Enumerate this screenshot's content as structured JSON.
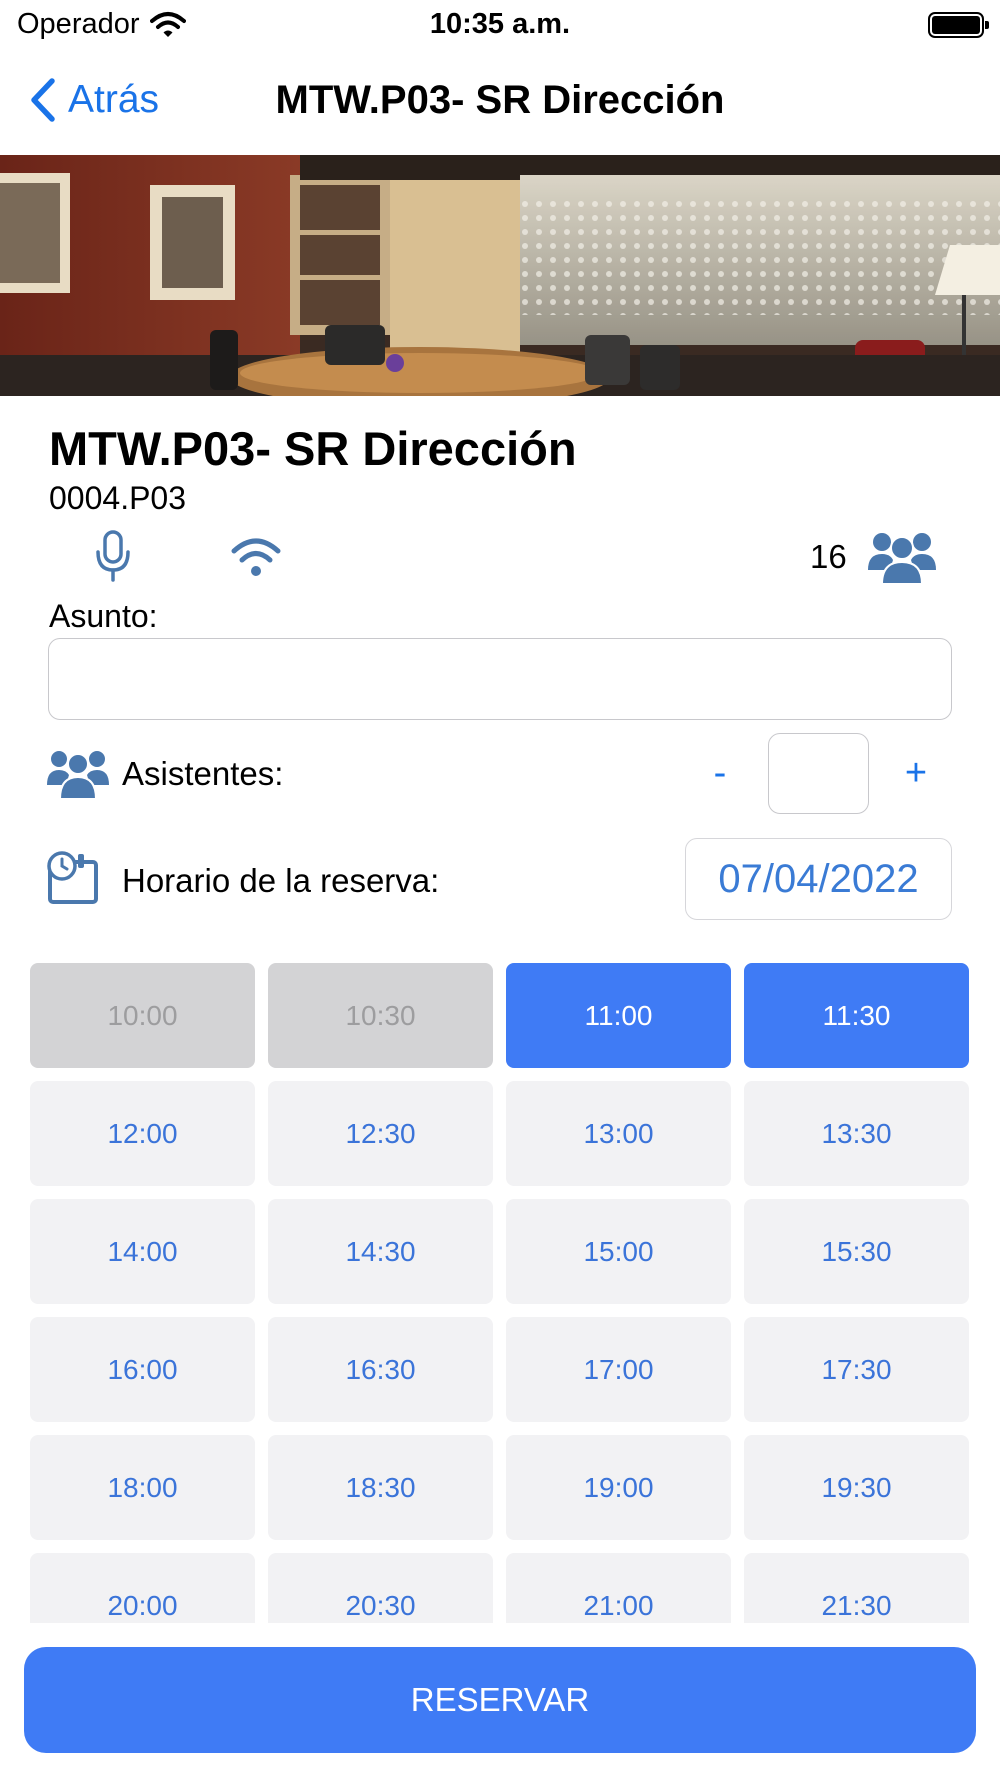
{
  "status_bar": {
    "carrier": "Operador",
    "time": "10:35 a.m."
  },
  "nav": {
    "back_label": "Atrás",
    "title": "MTW.P03- SR Dirección"
  },
  "room": {
    "name": "MTW.P03- SR Dirección",
    "code": "0004.P03",
    "capacity": "16",
    "amenities": [
      "microphone-icon",
      "wifi-icon"
    ]
  },
  "form": {
    "asunto_label": "Asunto:",
    "asunto_value": "",
    "asistentes_label": "Asistentes:",
    "minus_label": "-",
    "plus_label": "+",
    "asistentes_value": "",
    "horario_label": "Horario de la reserva:",
    "date": "07/04/2022"
  },
  "time_slots": [
    {
      "time": "10:00",
      "state": "disabled"
    },
    {
      "time": "10:30",
      "state": "disabled"
    },
    {
      "time": "11:00",
      "state": "selected"
    },
    {
      "time": "11:30",
      "state": "selected"
    },
    {
      "time": "12:00",
      "state": "available"
    },
    {
      "time": "12:30",
      "state": "available"
    },
    {
      "time": "13:00",
      "state": "available"
    },
    {
      "time": "13:30",
      "state": "available"
    },
    {
      "time": "14:00",
      "state": "available"
    },
    {
      "time": "14:30",
      "state": "available"
    },
    {
      "time": "15:00",
      "state": "available"
    },
    {
      "time": "15:30",
      "state": "available"
    },
    {
      "time": "16:00",
      "state": "available"
    },
    {
      "time": "16:30",
      "state": "available"
    },
    {
      "time": "17:00",
      "state": "available"
    },
    {
      "time": "17:30",
      "state": "available"
    },
    {
      "time": "18:00",
      "state": "available"
    },
    {
      "time": "18:30",
      "state": "available"
    },
    {
      "time": "19:00",
      "state": "available"
    },
    {
      "time": "19:30",
      "state": "available"
    },
    {
      "time": "20:00",
      "state": "available"
    },
    {
      "time": "20:30",
      "state": "available"
    },
    {
      "time": "21:00",
      "state": "available"
    },
    {
      "time": "21:30",
      "state": "available"
    }
  ],
  "reserve_label": "RESERVAR",
  "colors": {
    "accent": "#3f7bf5",
    "link": "#1a73e8",
    "icon_blue": "#4a78ad",
    "slot_available_bg": "#f2f2f4",
    "slot_disabled_bg": "#d3d3d5"
  }
}
